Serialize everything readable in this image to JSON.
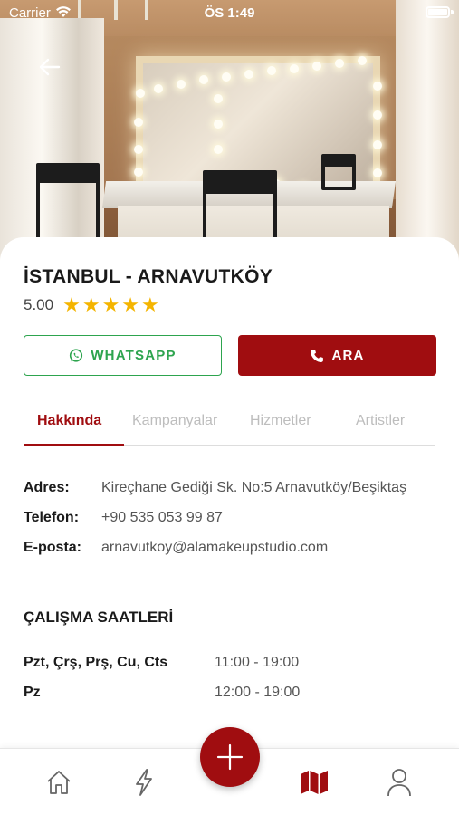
{
  "status_bar": {
    "carrier": "Carrier",
    "time": "ÖS 1:49"
  },
  "header": {
    "back_icon": "arrow-left-icon"
  },
  "salon": {
    "title": "İSTANBUL - ARNAVUTKÖY",
    "rating": "5.00",
    "stars": 5
  },
  "actions": {
    "whatsapp_label": "WHATSAPP",
    "call_label": "ARA"
  },
  "tabs": [
    {
      "label": "Hakkında",
      "active": true
    },
    {
      "label": "Kampanyalar",
      "active": false
    },
    {
      "label": "Hizmetler",
      "active": false
    },
    {
      "label": "Artistler",
      "active": false
    }
  ],
  "info": {
    "address_label": "Adres:",
    "address_value": "Kireçhane Gediği Sk. No:5 Arnavutköy/Beşiktaş",
    "phone_label": "Telefon:",
    "phone_value": "+90 535 053 99 87",
    "email_label": "E-posta:",
    "email_value": "arnavutkoy@alamakeupstudio.com"
  },
  "hours": {
    "title": "ÇALIŞMA SAATLERİ",
    "rows": [
      {
        "days": "Pzt, Çrş, Prş, Cu, Cts",
        "time": "11:00 - 19:00"
      },
      {
        "days": "Pz",
        "time": "12:00 - 19:00"
      }
    ]
  },
  "colors": {
    "brand": "#a00d10",
    "whatsapp": "#2da44e",
    "star": "#f4b400"
  },
  "bottom_nav": {
    "items": [
      "home-icon",
      "lightning-icon",
      "add-icon",
      "map-icon",
      "profile-icon"
    ],
    "active": "map-icon"
  }
}
